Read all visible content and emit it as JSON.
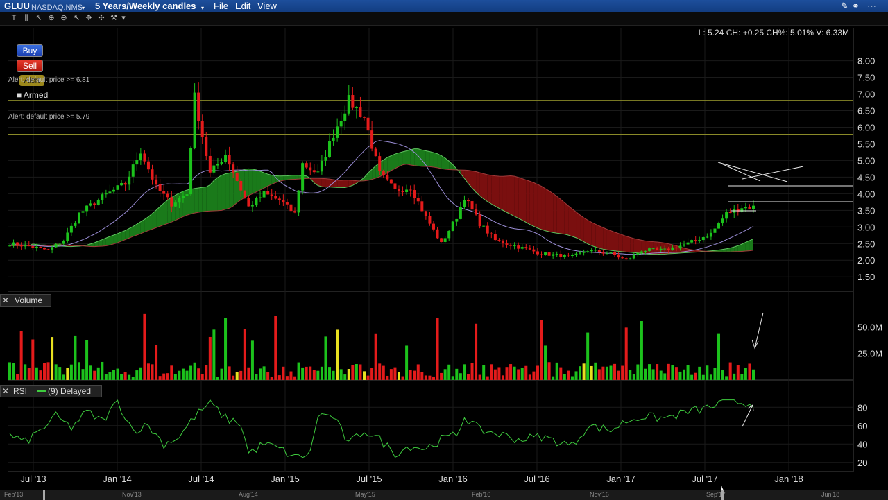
{
  "header": {
    "symbol": "GLUU",
    "exchange": "NASDAQ.NMS",
    "period": "5 Years/Weekly candles",
    "menu": [
      "File",
      "Edit",
      "View"
    ]
  },
  "icons": {
    "toolbar": [
      "text-icon",
      "bars-icon",
      "crosshair-icon",
      "zoom-in-icon",
      "zoom-out-icon",
      "pan-icon",
      "move-icon",
      "tool-icon",
      "dropdown-icon"
    ],
    "window": [
      "pen-icon",
      "link-icon",
      "grid-icon"
    ]
  },
  "trading": {
    "buy": "Buy",
    "sell": "Sell",
    "alert": "Alert",
    "alert1": "Alert: default price >= 6.81",
    "alert2": "Alert: default price >= 5.79",
    "armed": "Armed"
  },
  "readout": "L: 5.24 CH: +0.25 CH%: 5.01% V: 6.33M",
  "volume_label": "Volume",
  "rsi": {
    "label": "RSI",
    "params": "(9) Delayed"
  },
  "nav_labels": [
    "Feb'13",
    "Nov'13",
    "Aug'14",
    "May'15",
    "Feb'16",
    "Nov'16",
    "Sep'17",
    "Jun'18"
  ],
  "colors": {
    "up": "#1cc21c",
    "down": "#e41b1b",
    "cloud_up": "#1a7a1a",
    "cloud_down": "#7a0f0f",
    "ma": "#9c8fd8",
    "rsi": "#3ecb3e",
    "grid": "#1a1a1a"
  },
  "chart_data": [
    {
      "type": "candlestick",
      "x_ticks": [
        "Jul '13",
        "Jan '14",
        "Jul '14",
        "Jan '15",
        "Jul '15",
        "Jan '16",
        "Jul '16",
        "Jan '17",
        "Jul '17",
        "Jan '18"
      ],
      "y_ticks": [
        "1.50",
        "2.00",
        "2.50",
        "3.00",
        "3.50",
        "4.00",
        "4.50",
        "5.00",
        "5.50",
        "6.00",
        "6.50",
        "7.00",
        "7.50",
        "8.00"
      ],
      "ylim": [
        1.4,
        8.2
      ],
      "alert_levels": [
        6.81,
        5.79
      ],
      "close_points": [
        [
          0,
          2.5
        ],
        [
          6,
          2.4
        ],
        [
          10,
          2.3
        ],
        [
          14,
          2.6
        ],
        [
          18,
          3.4
        ],
        [
          24,
          3.9
        ],
        [
          30,
          4.3
        ],
        [
          34,
          5.3
        ],
        [
          38,
          4.2
        ],
        [
          42,
          3.7
        ],
        [
          46,
          4.0
        ],
        [
          48,
          6.9
        ],
        [
          52,
          4.6
        ],
        [
          56,
          5.2
        ],
        [
          62,
          3.6
        ],
        [
          66,
          4.0
        ],
        [
          70,
          3.8
        ],
        [
          74,
          3.4
        ],
        [
          76,
          4.9
        ],
        [
          80,
          4.6
        ],
        [
          84,
          5.8
        ],
        [
          88,
          6.8
        ],
        [
          92,
          6.3
        ],
        [
          96,
          4.6
        ],
        [
          100,
          4.1
        ],
        [
          104,
          4.2
        ],
        [
          108,
          3.3
        ],
        [
          112,
          2.5
        ],
        [
          116,
          3.3
        ],
        [
          118,
          3.9
        ],
        [
          122,
          3.1
        ],
        [
          126,
          2.6
        ],
        [
          132,
          2.4
        ],
        [
          138,
          2.2
        ],
        [
          146,
          2.1
        ],
        [
          150,
          2.3
        ],
        [
          156,
          2.2
        ],
        [
          160,
          2.0
        ],
        [
          164,
          2.3
        ],
        [
          170,
          2.3
        ],
        [
          176,
          2.5
        ],
        [
          182,
          2.8
        ],
        [
          186,
          3.4
        ],
        [
          190,
          3.6
        ],
        [
          192,
          3.6
        ]
      ]
    },
    {
      "type": "bar",
      "title": "Volume",
      "y_ticks": [
        "25.0M",
        "50.0M"
      ],
      "ylim": [
        0,
        60
      ]
    },
    {
      "type": "line",
      "title": "RSI",
      "y_ticks": [
        "20",
        "40",
        "60",
        "80"
      ],
      "ylim": [
        10,
        90
      ],
      "points": [
        [
          0,
          50
        ],
        [
          4,
          42
        ],
        [
          8,
          55
        ],
        [
          12,
          70
        ],
        [
          16,
          58
        ],
        [
          20,
          75
        ],
        [
          24,
          65
        ],
        [
          28,
          86
        ],
        [
          32,
          55
        ],
        [
          36,
          60
        ],
        [
          40,
          40
        ],
        [
          44,
          48
        ],
        [
          48,
          70
        ],
        [
          52,
          85
        ],
        [
          56,
          68
        ],
        [
          60,
          62
        ],
        [
          62,
          30
        ],
        [
          66,
          40
        ],
        [
          70,
          35
        ],
        [
          74,
          25
        ],
        [
          78,
          30
        ],
        [
          80,
          72
        ],
        [
          84,
          70
        ],
        [
          88,
          40
        ],
        [
          92,
          55
        ],
        [
          96,
          45
        ],
        [
          100,
          30
        ],
        [
          104,
          38
        ],
        [
          108,
          35
        ],
        [
          112,
          45
        ],
        [
          116,
          50
        ],
        [
          118,
          70
        ],
        [
          122,
          55
        ],
        [
          126,
          52
        ],
        [
          132,
          45
        ],
        [
          138,
          48
        ],
        [
          146,
          38
        ],
        [
          150,
          60
        ],
        [
          156,
          55
        ],
        [
          160,
          65
        ],
        [
          164,
          70
        ],
        [
          170,
          68
        ],
        [
          176,
          75
        ],
        [
          182,
          80
        ],
        [
          186,
          88
        ],
        [
          190,
          85
        ],
        [
          192,
          84
        ]
      ]
    }
  ]
}
